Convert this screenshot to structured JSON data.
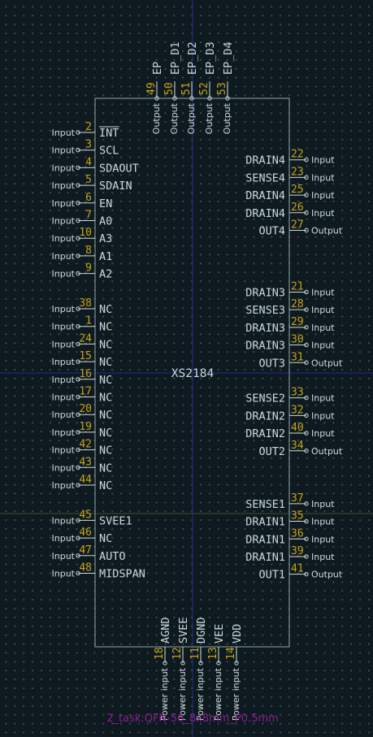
{
  "colors": {
    "background": "#0e1a20",
    "body_outline": "#8ea6a6",
    "pin": "#c8d9d7",
    "pin_number": "#c9a417",
    "crosshair": "#1f2d88",
    "footprint": "#8a1f8f"
  },
  "symbol": {
    "reference": "XS2184",
    "footprint": "2_task:QFN-56_8x8mm_P0.5mm"
  },
  "pins": {
    "top": [
      {
        "num": "49",
        "name": "EP",
        "type": "Output"
      },
      {
        "num": "50",
        "name": "EP_D1",
        "type": "Output"
      },
      {
        "num": "51",
        "name": "EP_D2",
        "type": "Output"
      },
      {
        "num": "52",
        "name": "EP_D3",
        "type": "Output"
      },
      {
        "num": "53",
        "name": "EP_D4",
        "type": "Output"
      }
    ],
    "left": [
      {
        "num": "2",
        "name": "INT",
        "type": "Input",
        "overbar": true,
        "row": 0
      },
      {
        "num": "3",
        "name": "SCL",
        "type": "Input",
        "row": 1
      },
      {
        "num": "4",
        "name": "SDAOUT",
        "type": "Input",
        "row": 2
      },
      {
        "num": "5",
        "name": "SDAIN",
        "type": "Input",
        "row": 3
      },
      {
        "num": "6",
        "name": "EN",
        "type": "Input",
        "row": 4
      },
      {
        "num": "7",
        "name": "A0",
        "type": "Input",
        "row": 5
      },
      {
        "num": "10",
        "name": "A3",
        "type": "Input",
        "row": 6
      },
      {
        "num": "8",
        "name": "A1",
        "type": "Input",
        "row": 7
      },
      {
        "num": "9",
        "name": "A2",
        "type": "Input",
        "row": 8
      },
      {
        "num": "38",
        "name": "NC",
        "type": "Input",
        "row": 10
      },
      {
        "num": "1",
        "name": "NC",
        "type": "Input",
        "row": 11
      },
      {
        "num": "24",
        "name": "NC",
        "type": "Input",
        "row": 12
      },
      {
        "num": "15",
        "name": "NC",
        "type": "Input",
        "row": 13
      },
      {
        "num": "16",
        "name": "NC",
        "type": "Input",
        "row": 14
      },
      {
        "num": "17",
        "name": "NC",
        "type": "Input",
        "row": 15
      },
      {
        "num": "20",
        "name": "NC",
        "type": "Input",
        "row": 16
      },
      {
        "num": "19",
        "name": "NC",
        "type": "Input",
        "row": 17
      },
      {
        "num": "42",
        "name": "NC",
        "type": "Input",
        "row": 18
      },
      {
        "num": "43",
        "name": "NC",
        "type": "Input",
        "row": 19
      },
      {
        "num": "44",
        "name": "NC",
        "type": "Input",
        "row": 20
      },
      {
        "num": "45",
        "name": "SVEE1",
        "type": "Input",
        "row": 22
      },
      {
        "num": "46",
        "name": "NC",
        "type": "Input",
        "row": 23
      },
      {
        "num": "47",
        "name": "AUTO",
        "type": "Input",
        "row": 24
      },
      {
        "num": "48",
        "name": "MIDSPAN",
        "type": "Input",
        "row": 25
      }
    ],
    "right": [
      {
        "num": "22",
        "name": "DRAIN4",
        "type": "Input",
        "row": 1
      },
      {
        "num": "23",
        "name": "SENSE4",
        "type": "Input",
        "row": 2
      },
      {
        "num": "25",
        "name": "DRAIN4",
        "type": "Input",
        "row": 3
      },
      {
        "num": "26",
        "name": "DRAIN4",
        "type": "Input",
        "row": 4
      },
      {
        "num": "27",
        "name": "OUT4",
        "type": "Output",
        "row": 5
      },
      {
        "num": "21",
        "name": "DRAIN3",
        "type": "Input",
        "row": 8.5
      },
      {
        "num": "28",
        "name": "SENSE3",
        "type": "Input",
        "row": 9.5
      },
      {
        "num": "29",
        "name": "DRAIN3",
        "type": "Input",
        "row": 10.5
      },
      {
        "num": "30",
        "name": "DRAIN3",
        "type": "Input",
        "row": 11.5
      },
      {
        "num": "31",
        "name": "OUT3",
        "type": "Output",
        "row": 12.5
      },
      {
        "num": "33",
        "name": "SENSE2",
        "type": "Input",
        "row": 14.5
      },
      {
        "num": "32",
        "name": "DRAIN2",
        "type": "Input",
        "row": 15.5
      },
      {
        "num": "40",
        "name": "DRAIN2",
        "type": "Input",
        "row": 16.5
      },
      {
        "num": "34",
        "name": "OUT2",
        "type": "Output",
        "row": 17.5
      },
      {
        "num": "37",
        "name": "SENSE1",
        "type": "Input",
        "row": 20.5
      },
      {
        "num": "35",
        "name": "DRAIN1",
        "type": "Input",
        "row": 21.5
      },
      {
        "num": "36",
        "name": "DRAIN1",
        "type": "Input",
        "row": 22.5
      },
      {
        "num": "39",
        "name": "DRAIN1",
        "type": "Input",
        "row": 23.5
      },
      {
        "num": "41",
        "name": "OUT1",
        "type": "Output",
        "row": 24.5
      }
    ],
    "bottom": [
      {
        "num": "18",
        "name": "AGND",
        "type": "Power input"
      },
      {
        "num": "12",
        "name": "SVEE",
        "type": "Power input"
      },
      {
        "num": "11",
        "name": "DGND",
        "type": "Power input"
      },
      {
        "num": "13",
        "name": "VEE",
        "type": "Power input"
      },
      {
        "num": "14",
        "name": "VDD",
        "type": "Power input"
      }
    ]
  }
}
